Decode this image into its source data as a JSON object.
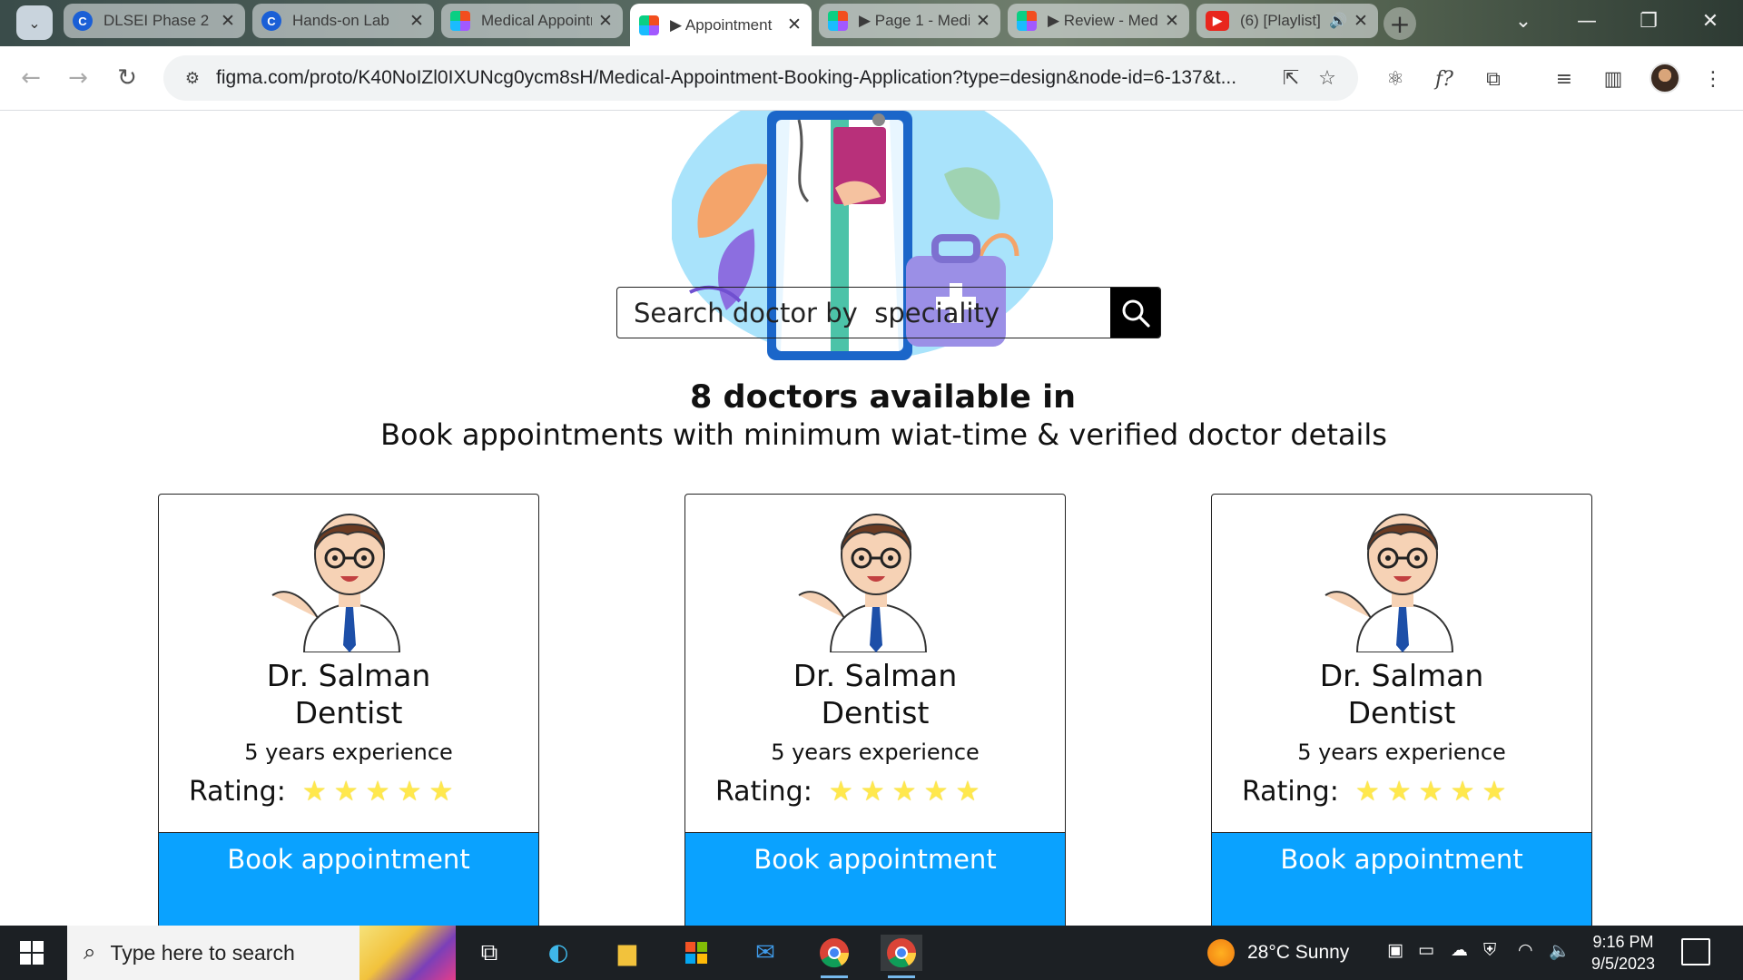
{
  "browser": {
    "tabs": [
      {
        "title": "DLSEI Phase 2",
        "icon": "c-logo-icon"
      },
      {
        "title": "Hands-on Lab",
        "icon": "c-logo-icon"
      },
      {
        "title": "Medical Appointment",
        "icon": "figma-icon"
      },
      {
        "title": "▶ Appointment",
        "icon": "figma-icon",
        "active": true
      },
      {
        "title": "▶ Page 1 - Medical",
        "icon": "figma-icon"
      },
      {
        "title": "▶ Review - Medical",
        "icon": "figma-icon"
      },
      {
        "title": "(6) [Playlist]",
        "icon": "youtube-icon",
        "audio": true
      }
    ],
    "url": "figma.com/proto/K40NoIZl0IXUNcg0ycm8sH/Medical-Appointment-Booking-Application?type=design&node-id=6-137&t..."
  },
  "search": {
    "placeholder": "Search doctor by  speciality"
  },
  "heading": {
    "count_text": "8 doctors available in",
    "subtitle": "Book appointments with minimum wiat-time & verified doctor details"
  },
  "doctors": [
    {
      "name": "Dr. Salman",
      "speciality": "Dentist",
      "experience": "5 years experience",
      "rating_label": "Rating:",
      "rating": 5,
      "button": "Book appointment"
    },
    {
      "name": "Dr. Salman",
      "speciality": "Dentist",
      "experience": "5 years experience",
      "rating_label": "Rating:",
      "rating": 5,
      "button": "Book appointment"
    },
    {
      "name": "Dr. Salman",
      "speciality": "Dentist",
      "experience": "5 years experience",
      "rating_label": "Rating:",
      "rating": 5,
      "button": "Book appointment"
    }
  ],
  "taskbar": {
    "search_placeholder": "Type here to search",
    "weather": "28°C  Sunny",
    "time": "9:16 PM",
    "date": "9/5/2023"
  },
  "colors": {
    "book_button": "#0aa2ff",
    "star": "#ffe84d",
    "search_button": "#000000"
  }
}
